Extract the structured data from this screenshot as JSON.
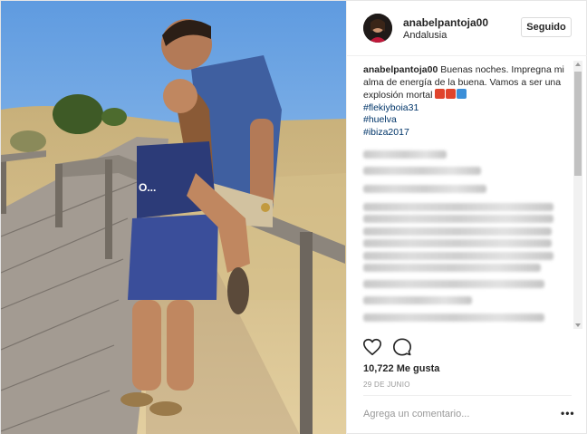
{
  "post": {
    "header": {
      "username": "anabelpantoja00",
      "location": "Andalusia",
      "follow_label": "Seguido"
    },
    "caption": {
      "username": "anabelpantoja00",
      "text": " Buenas noches. Impregna mi alma de energía de la buena. Vamos a ser una explosión mortal",
      "hashtags": [
        "#flekiyboia31",
        "#huelva",
        "#ibiza2017"
      ]
    },
    "actions": {
      "like_icon": "heart-icon",
      "comment_icon": "comment-bubble-icon"
    },
    "likes_text": "10,722 Me gusta",
    "date_text": "29 DE JUNIO",
    "comment_placeholder": "Agrega un comentario...",
    "more_icon_text": "•••",
    "colors": {
      "hashtag": "#003569",
      "text": "#262626",
      "muted": "#999999",
      "border": "#dbdbdb"
    }
  }
}
